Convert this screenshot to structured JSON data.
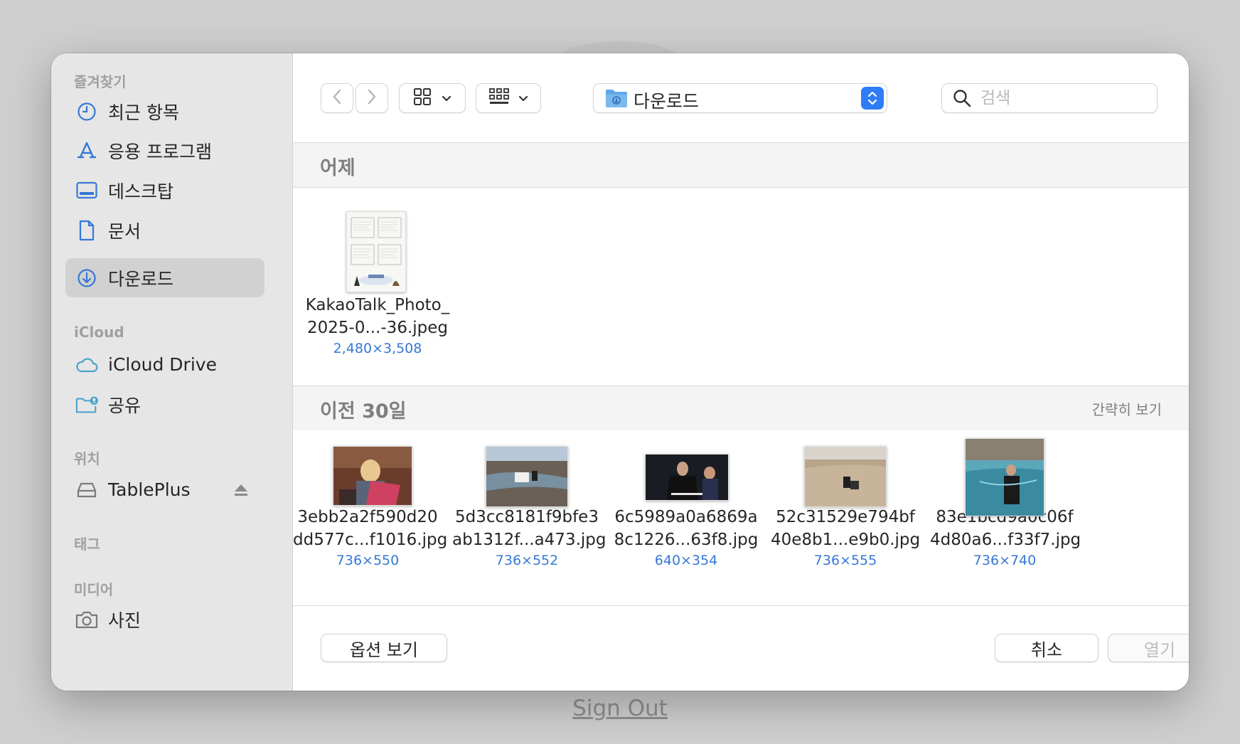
{
  "sidebar": {
    "sections": {
      "favorites": "즐겨찾기",
      "icloud": "iCloud",
      "locations": "위치",
      "tags": "태그",
      "media": "미디어"
    },
    "items": [
      {
        "label": "최근 항목",
        "icon": "clock-icon"
      },
      {
        "label": "응용 프로그램",
        "icon": "app-store-icon"
      },
      {
        "label": "데스크탑",
        "icon": "desktop-icon"
      },
      {
        "label": "문서",
        "icon": "document-icon"
      },
      {
        "label": "다운로드",
        "icon": "download-icon",
        "selected": true
      },
      {
        "label": "iCloud Drive",
        "icon": "cloud-icon"
      },
      {
        "label": "공유",
        "icon": "shared-folder-icon"
      },
      {
        "label": "TablePlus",
        "icon": "disk-icon"
      },
      {
        "label": "사진",
        "icon": "camera-icon"
      }
    ]
  },
  "toolbar": {
    "location": "다운로드",
    "search_placeholder": "검색"
  },
  "groups": {
    "yesterday": {
      "title": "어제",
      "files": [
        {
          "name_line1": "KakaoTalk_Photo_",
          "name_line2": "2025-0...-36.jpeg",
          "dims": "2,480×3,508"
        }
      ]
    },
    "previous30": {
      "title": "이전 30일",
      "action": "간략히 보기",
      "files": [
        {
          "name_line1": "3ebb2a2f590d20",
          "name_line2": "dd577c...f1016.jpg",
          "dims": "736×550"
        },
        {
          "name_line1": "5d3cc8181f9bfe3",
          "name_line2": "ab1312f...a473.jpg",
          "dims": "736×552"
        },
        {
          "name_line1": "6c5989a0a6869a",
          "name_line2": "8c1226...63f8.jpg",
          "dims": "640×354"
        },
        {
          "name_line1": "52c31529e794bf",
          "name_line2": "40e8b1...e9b0.jpg",
          "dims": "736×555"
        },
        {
          "name_line1": "83e1bcd9a0c06f",
          "name_line2": "4d80a6...f33f7.jpg",
          "dims": "736×740"
        }
      ]
    }
  },
  "footer": {
    "options": "옵션 보기",
    "cancel": "취소",
    "open": "열기"
  },
  "background": {
    "signout": "Sign Out"
  },
  "colors": {
    "accent": "#2f7cf6",
    "sidebar_icon": "#3578d6",
    "dimension_text": "#3578d6"
  }
}
